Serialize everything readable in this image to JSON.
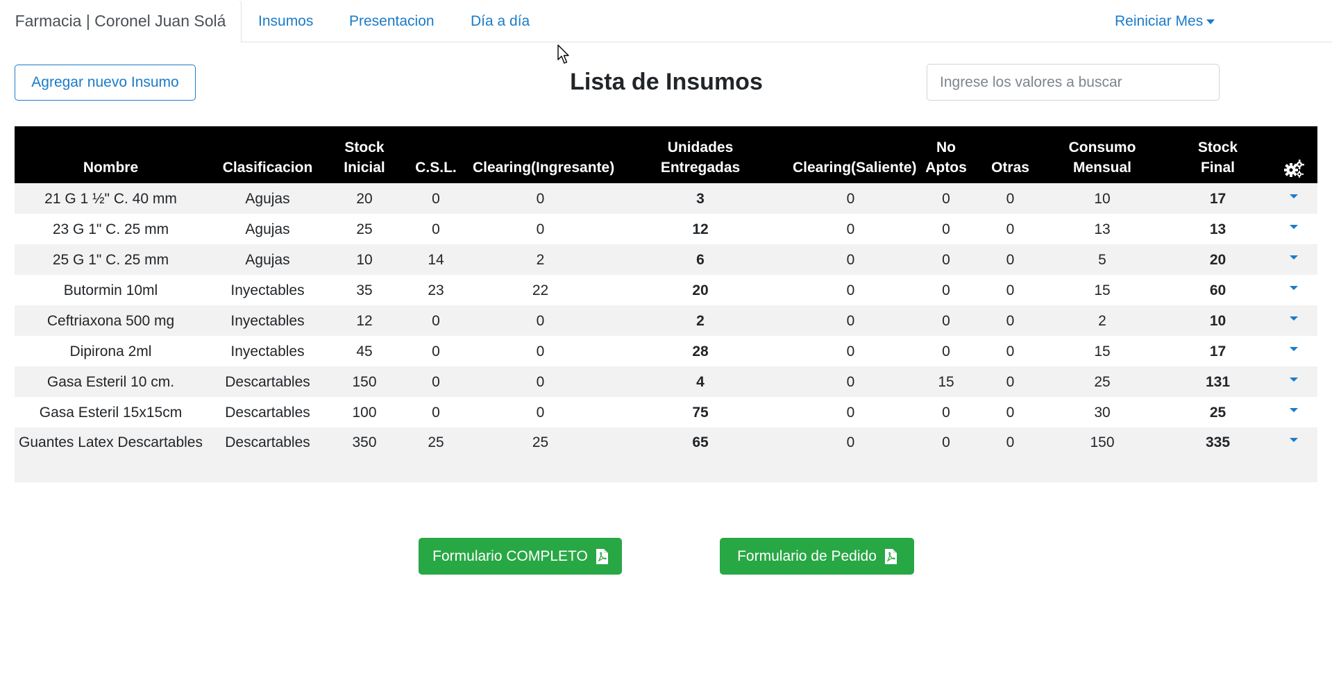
{
  "nav": {
    "brand": "Farmacia | Coronel Juan Solá",
    "links": [
      "Insumos",
      "Presentacion",
      "Día a día"
    ],
    "dropdown_label": "Reiniciar Mes"
  },
  "toolbar": {
    "add_button_label": "Agregar nuevo Insumo",
    "title": "Lista de Insumos",
    "search_placeholder": "Ingrese los valores a buscar"
  },
  "table": {
    "headers": {
      "nombre": "Nombre",
      "clasificacion": "Clasificacion",
      "stock_inicial_1": "Stock",
      "stock_inicial_2": "Inicial",
      "csl": "C.S.L.",
      "clearing_in": "Clearing(Ingresante)",
      "unidades_1": "Unidades",
      "unidades_2": "Entregadas",
      "clearing_out": "Clearing(Saliente)",
      "no_aptos_1": "No",
      "no_aptos_2": "Aptos",
      "otras": "Otras",
      "consumo_1": "Consumo",
      "consumo_2": "Mensual",
      "stock_final_1": "Stock",
      "stock_final_2": "Final",
      "settings_icon": "gears-icon"
    },
    "rows": [
      {
        "nombre": "21 G 1 ½\" C. 40 mm",
        "clasificacion": "Agujas",
        "stock_inicial": "20",
        "csl": "0",
        "clearing_in": "0",
        "unidades": "3",
        "clearing_out": "0",
        "no_aptos": "0",
        "otras": "0",
        "consumo": "10",
        "stock_final": "17"
      },
      {
        "nombre": "23 G 1\" C. 25 mm",
        "clasificacion": "Agujas",
        "stock_inicial": "25",
        "csl": "0",
        "clearing_in": "0",
        "unidades": "12",
        "clearing_out": "0",
        "no_aptos": "0",
        "otras": "0",
        "consumo": "13",
        "stock_final": "13"
      },
      {
        "nombre": "25 G 1\" C. 25 mm",
        "clasificacion": "Agujas",
        "stock_inicial": "10",
        "csl": "14",
        "clearing_in": "2",
        "unidades": "6",
        "clearing_out": "0",
        "no_aptos": "0",
        "otras": "0",
        "consumo": "5",
        "stock_final": "20"
      },
      {
        "nombre": "Butormin 10ml",
        "clasificacion": "Inyectables",
        "stock_inicial": "35",
        "csl": "23",
        "clearing_in": "22",
        "unidades": "20",
        "clearing_out": "0",
        "no_aptos": "0",
        "otras": "0",
        "consumo": "15",
        "stock_final": "60"
      },
      {
        "nombre": "Ceftriaxona 500 mg",
        "clasificacion": "Inyectables",
        "stock_inicial": "12",
        "csl": "0",
        "clearing_in": "0",
        "unidades": "2",
        "clearing_out": "0",
        "no_aptos": "0",
        "otras": "0",
        "consumo": "2",
        "stock_final": "10"
      },
      {
        "nombre": "Dipirona 2ml",
        "clasificacion": "Inyectables",
        "stock_inicial": "45",
        "csl": "0",
        "clearing_in": "0",
        "unidades": "28",
        "clearing_out": "0",
        "no_aptos": "0",
        "otras": "0",
        "consumo": "15",
        "stock_final": "17"
      },
      {
        "nombre": "Gasa Esteril 10 cm.",
        "clasificacion": "Descartables",
        "stock_inicial": "150",
        "csl": "0",
        "clearing_in": "0",
        "unidades": "4",
        "clearing_out": "0",
        "no_aptos": "15",
        "otras": "0",
        "consumo": "25",
        "stock_final": "131"
      },
      {
        "nombre": "Gasa Esteril 15x15cm",
        "clasificacion": "Descartables",
        "stock_inicial": "100",
        "csl": "0",
        "clearing_in": "0",
        "unidades": "75",
        "clearing_out": "0",
        "no_aptos": "0",
        "otras": "0",
        "consumo": "30",
        "stock_final": "25"
      },
      {
        "nombre": "Guantes Latex Descartables",
        "clasificacion": "Descartables",
        "stock_inicial": "350",
        "csl": "25",
        "clearing_in": "25",
        "unidades": "65",
        "clearing_out": "0",
        "no_aptos": "0",
        "otras": "0",
        "consumo": "150",
        "stock_final": "335"
      }
    ]
  },
  "buttons": {
    "form_complete": "Formulario COMPLETO",
    "form_order": "Formulario de Pedido",
    "pdf_icon": "file-pdf-icon"
  },
  "colors": {
    "link": "#1a7bc9",
    "header_bg": "#000000",
    "stripe": "#f2f2f2",
    "green": "#28a745"
  }
}
